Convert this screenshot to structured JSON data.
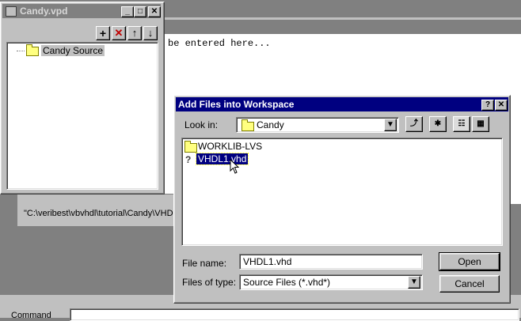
{
  "background_window": {
    "editor_text": "be entered here...",
    "path_text": "\"C:\\veribest\\vbvhdl\\tutorial\\Candy\\VHD",
    "command_label": "Command"
  },
  "workspace": {
    "title": "Candy.vpd",
    "toolbar": {
      "add": "+",
      "delete": "✕",
      "up": "↑",
      "down": "↓"
    },
    "tree_item": "Candy Source"
  },
  "dialog": {
    "title": "Add Files into Workspace",
    "help_btn": "?",
    "close_btn": "✕",
    "look_in_label": "Look in:",
    "look_in_value": "Candy",
    "files": [
      {
        "name": "WORKLIB-LVS",
        "type": "folder"
      },
      {
        "name": "VHDL1.vhd",
        "type": "file"
      }
    ],
    "file_name_label": "File name:",
    "file_name_value": "VHDL1.vhd",
    "files_of_type_label": "Files of type:",
    "files_of_type_value": "Source Files (*.vhd*)",
    "open_button": "Open",
    "cancel_button": "Cancel"
  }
}
